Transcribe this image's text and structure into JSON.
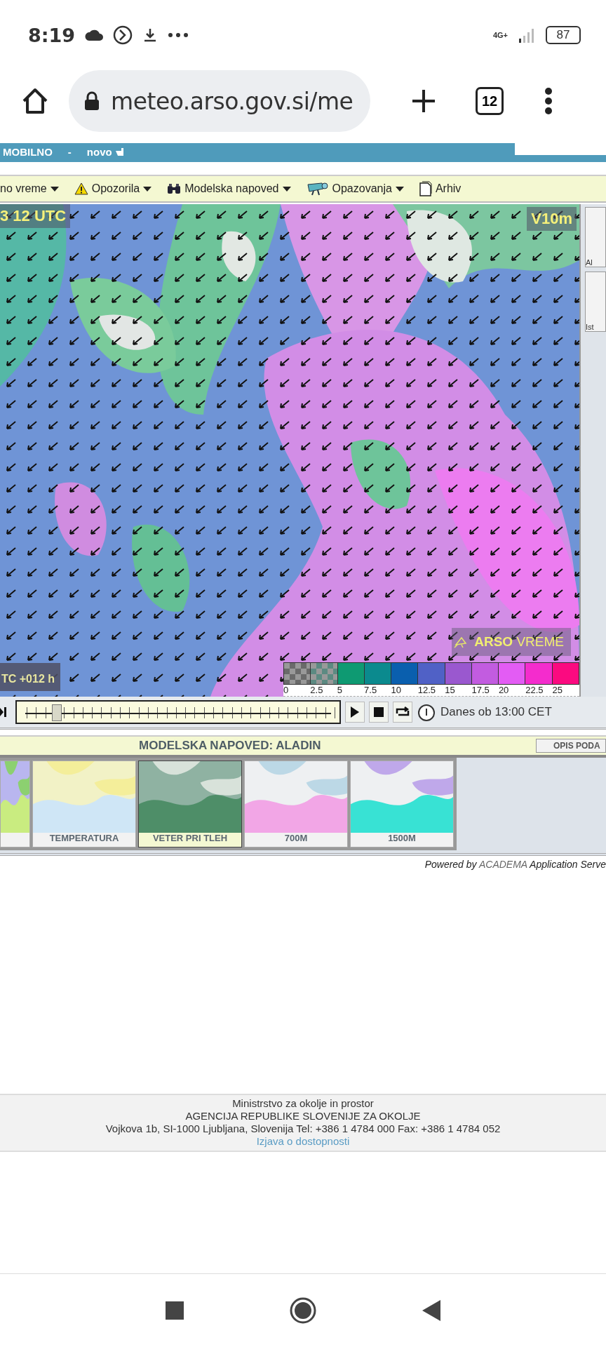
{
  "status_bar": {
    "time": "8:19",
    "network": "4G+",
    "battery": "87"
  },
  "browser": {
    "url": "meteo.arso.gov.si/me",
    "tab_count": "12"
  },
  "site_banner": {
    "title": "MOBILNO",
    "separator": "-",
    "badge": "novo"
  },
  "menu": [
    {
      "label": "no vreme",
      "kind": "plain",
      "dropdown": true
    },
    {
      "label": "Opozorila",
      "kind": "warning",
      "dropdown": true
    },
    {
      "label": "Modelska napoved",
      "kind": "binoculars",
      "dropdown": true
    },
    {
      "label": "Opazovanja",
      "kind": "telescope",
      "dropdown": true
    },
    {
      "label": "Arhiv",
      "kind": "document",
      "dropdown": false
    }
  ],
  "map": {
    "time_label": "3 12 UTC",
    "variable": "V10m",
    "offset_label": "TC +012 h",
    "logo_bold": "ARSO",
    "logo_light": "VREME",
    "legend": [
      {
        "label": "0",
        "color": "#6a6a6a",
        "pattern": true
      },
      {
        "label": "2.5",
        "color": "#5c8a82",
        "pattern": true
      },
      {
        "label": "5",
        "color": "#0e9a72",
        "pattern": false
      },
      {
        "label": "7.5",
        "color": "#0b8a8e",
        "pattern": false
      },
      {
        "label": "10",
        "color": "#0a5fae",
        "pattern": false
      },
      {
        "label": "12.5",
        "color": "#5061c6",
        "pattern": false
      },
      {
        "label": "15",
        "color": "#9a58cf",
        "pattern": false
      },
      {
        "label": "17.5",
        "color": "#c25ce0",
        "pattern": false
      },
      {
        "label": "20",
        "color": "#e35cf4",
        "pattern": false
      },
      {
        "label": "22.5",
        "color": "#f42ccd",
        "pattern": false
      },
      {
        "label": "25",
        "color": "#fb0a80",
        "pattern": false
      }
    ]
  },
  "side_strip": [
    "Al",
    "Ist"
  ],
  "player": {
    "level": 0.09,
    "time_text": "Danes ob 13:00 CET"
  },
  "model": {
    "title": "MODELSKA NAPOVED: ALADIN",
    "button": "OPIS PODA",
    "thumbnails": [
      {
        "selected": false
      },
      {
        "label": "TEMPERATURA",
        "selected": false
      },
      {
        "label": "VETER PRI TLEH",
        "selected": true
      },
      {
        "label": "700M",
        "selected": false
      },
      {
        "label": "1500M",
        "selected": false
      }
    ]
  },
  "powered": {
    "prefix": "Powered by",
    "brand": "ACADEMA",
    "suffix": "Application Serve"
  },
  "footer": {
    "lines": [
      "Ministrstvo za okolje in prostor",
      "AGENCIJA REPUBLIKE SLOVENIJE ZA OKOLJE",
      "Vojkova 1b, SI-1000 Ljubljana, Slovenija Tel: +386 1 4784 000 Fax: +386 1 4784 052"
    ],
    "link": "Izjava o dostopnosti"
  }
}
